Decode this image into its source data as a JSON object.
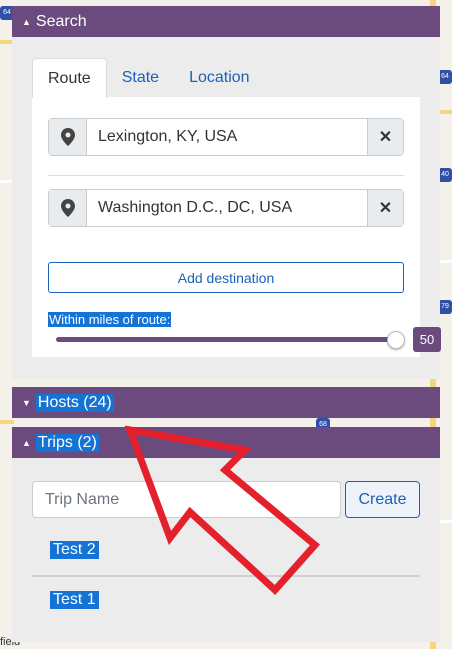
{
  "search_panel": {
    "title": "Search",
    "expanded": true
  },
  "tabs": [
    {
      "label": "Route",
      "active": true
    },
    {
      "label": "State",
      "active": false
    },
    {
      "label": "Location",
      "active": false
    }
  ],
  "route": {
    "origin": "Lexington, KY, USA",
    "destination": "Washington D.C., DC, USA",
    "add_destination_label": "Add destination",
    "miles_label": "Within miles of route:",
    "miles_value": "50",
    "clear_symbol": "✕",
    "pin_icon": "map-marker-icon"
  },
  "hosts_panel": {
    "title": "Hosts (24)",
    "expanded": false
  },
  "trips_panel": {
    "title": "Trips (2)",
    "expanded": true,
    "input_placeholder": "Trip Name",
    "create_label": "Create",
    "items": [
      "Test 2",
      "Test 1"
    ]
  },
  "map": {
    "shields": [
      "64",
      "64",
      "40",
      "79",
      "68"
    ],
    "edge_text": "field"
  },
  "colors": {
    "header": "#6b4a7d",
    "link": "#1a62b8",
    "highlight": "#1573d6",
    "annotation_arrow": "#e3202b"
  }
}
